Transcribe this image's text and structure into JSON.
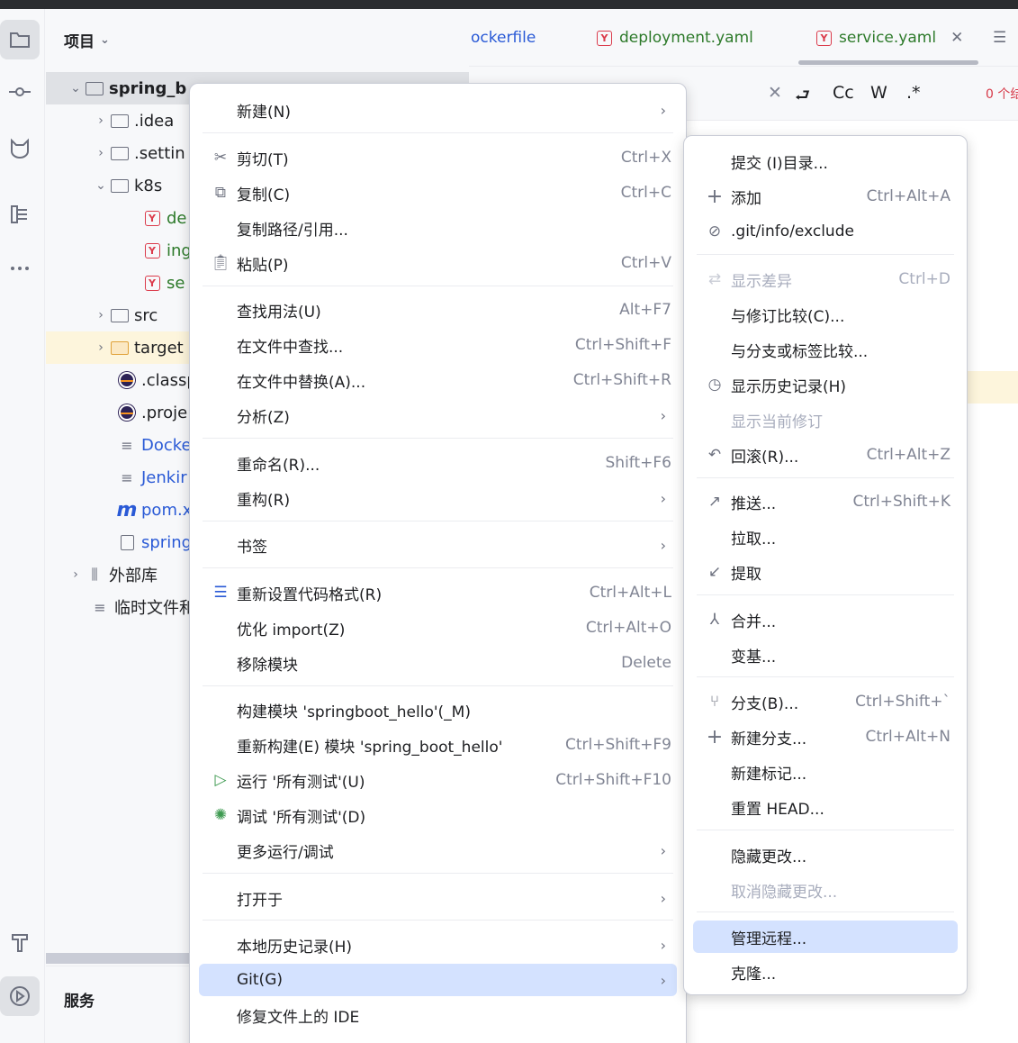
{
  "project_panel": {
    "title": "项目",
    "tree": [
      {
        "label": "spring_b",
        "level": 0
      },
      {
        "label": ".idea"
      },
      {
        "label": ".settin"
      },
      {
        "label": "k8s"
      },
      {
        "label": "de"
      },
      {
        "label": "ing"
      },
      {
        "label": "se"
      },
      {
        "label": "src"
      },
      {
        "label": "target"
      },
      {
        "label": ".classp"
      },
      {
        "label": ".proje"
      },
      {
        "label": "Docke"
      },
      {
        "label": "Jenkir"
      },
      {
        "label": "pom.x"
      },
      {
        "label": "spring"
      },
      {
        "label": "外部库"
      },
      {
        "label": "临时文件和"
      }
    ]
  },
  "services": {
    "title": "服务"
  },
  "tabs": [
    {
      "label": "ockerfile"
    },
    {
      "label": "deployment.yaml"
    },
    {
      "label": "service.yaml"
    }
  ],
  "findbar": {
    "case_label": "Cc",
    "word_label": "W",
    "regex_label": ".*",
    "result_count": "0 个结"
  },
  "context_menu": {
    "items": [
      {
        "label": "新建(N)",
        "shortcut": ""
      },
      {
        "label": "剪切(T)",
        "shortcut": "Ctrl+X"
      },
      {
        "label": "复制(C)",
        "shortcut": "Ctrl+C"
      },
      {
        "label": "复制路径/引用...",
        "shortcut": ""
      },
      {
        "label": "粘贴(P)",
        "shortcut": "Ctrl+V"
      },
      {
        "label": "查找用法(U)",
        "shortcut": "Alt+F7"
      },
      {
        "label": "在文件中查找...",
        "shortcut": "Ctrl+Shift+F"
      },
      {
        "label": "在文件中替换(A)...",
        "shortcut": "Ctrl+Shift+R"
      },
      {
        "label": "分析(Z)",
        "shortcut": ""
      },
      {
        "label": "重命名(R)...",
        "shortcut": "Shift+F6"
      },
      {
        "label": "重构(R)",
        "shortcut": ""
      },
      {
        "label": "书签",
        "shortcut": ""
      },
      {
        "label": "重新设置代码格式(R)",
        "shortcut": "Ctrl+Alt+L"
      },
      {
        "label": "优化 import(Z)",
        "shortcut": "Ctrl+Alt+O"
      },
      {
        "label": "移除模块",
        "shortcut": "Delete"
      },
      {
        "label": "构建模块 'springboot_hello'(_M)",
        "shortcut": ""
      },
      {
        "label": "重新构建(E) 模块 'spring_boot_hello'",
        "shortcut": "Ctrl+Shift+F9"
      },
      {
        "label": "运行 '所有测试'(U)",
        "shortcut": "Ctrl+Shift+F10"
      },
      {
        "label": "调试 '所有测试'(D)",
        "shortcut": ""
      },
      {
        "label": "更多运行/调试",
        "shortcut": ""
      },
      {
        "label": "打开于",
        "shortcut": ""
      },
      {
        "label": "本地历史记录(H)",
        "shortcut": ""
      },
      {
        "label": "Git(G)",
        "shortcut": ""
      },
      {
        "label": "修复文件上的 IDE",
        "shortcut": ""
      }
    ]
  },
  "git_submenu": {
    "items": [
      {
        "label": "提交 (I)目录...",
        "shortcut": ""
      },
      {
        "label": "添加",
        "shortcut": "Ctrl+Alt+A"
      },
      {
        "label": ".git/info/exclude",
        "shortcut": ""
      },
      {
        "label": "显示差异",
        "shortcut": "Ctrl+D"
      },
      {
        "label": "与修订比较(C)...",
        "shortcut": ""
      },
      {
        "label": "与分支或标签比较...",
        "shortcut": ""
      },
      {
        "label": "显示历史记录(H)",
        "shortcut": ""
      },
      {
        "label": "显示当前修订",
        "shortcut": ""
      },
      {
        "label": "回滚(R)...",
        "shortcut": "Ctrl+Alt+Z"
      },
      {
        "label": "推送...",
        "shortcut": "Ctrl+Shift+K"
      },
      {
        "label": "拉取...",
        "shortcut": ""
      },
      {
        "label": "提取",
        "shortcut": ""
      },
      {
        "label": "合并...",
        "shortcut": ""
      },
      {
        "label": "变基...",
        "shortcut": ""
      },
      {
        "label": "分支(B)...",
        "shortcut": "Ctrl+Shift+`"
      },
      {
        "label": "新建分支...",
        "shortcut": "Ctrl+Alt+N"
      },
      {
        "label": "新建标记...",
        "shortcut": ""
      },
      {
        "label": "重置 HEAD...",
        "shortcut": ""
      },
      {
        "label": "隐藏更改...",
        "shortcut": ""
      },
      {
        "label": "取消隐藏更改...",
        "shortcut": ""
      },
      {
        "label": "管理远程...",
        "shortcut": ""
      },
      {
        "label": "克隆...",
        "shortcut": ""
      }
    ]
  },
  "colors": {
    "accent": "#d4e2ff",
    "yaml_icon": "#db3b4b",
    "highlight_row": "#fdf5dc"
  }
}
